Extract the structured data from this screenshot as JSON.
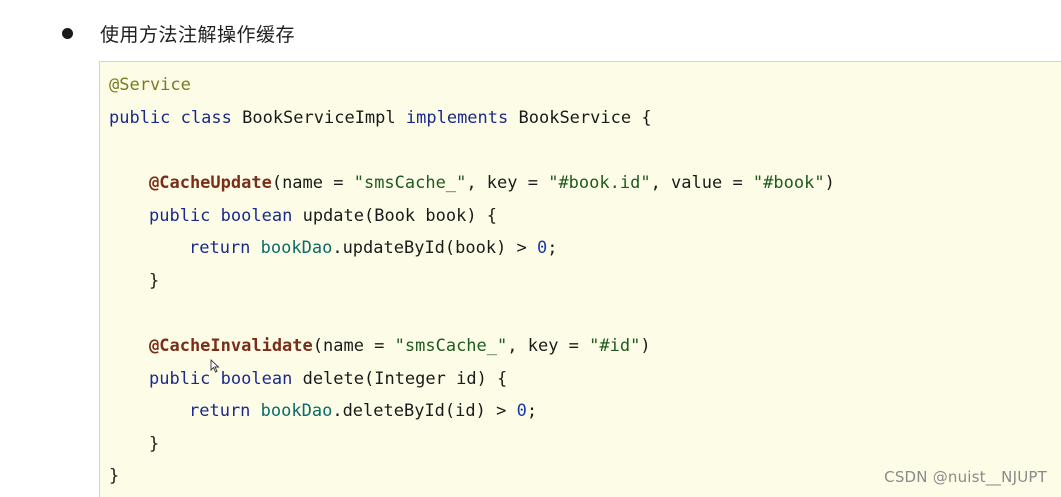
{
  "heading": {
    "bullet_text": "使用方法注解操作缓存"
  },
  "code": {
    "l1_annotation": "@Service",
    "l2": {
      "kw1": "public",
      "kw2": "class",
      "name": "BookServiceImpl",
      "kw3": "implements",
      "iface": "BookService",
      "brace": "{"
    },
    "l3_blank": "",
    "l4": {
      "ann": "@CacheUpdate",
      "p1": "(name = ",
      "s1": "\"smsCache_\"",
      "p2": ", key = ",
      "s2": "\"#book.id\"",
      "p3": ", value = ",
      "s3": "\"#book\"",
      "p4": ")"
    },
    "l5": {
      "kw1": "public",
      "kw2": "boolean",
      "rest": "update(Book book) {"
    },
    "l6": {
      "kw": "return",
      "var": "bookDao",
      "rest": ".updateById(book) > ",
      "num": "0",
      "end": ";"
    },
    "l7": "}",
    "l8_blank": "",
    "l9": {
      "ann": "@CacheInvalidate",
      "p1": "(name = ",
      "s1": "\"smsCache_\"",
      "p2": ", key = ",
      "s2": "\"#id\"",
      "p3": ")"
    },
    "l10": {
      "kw1": "public",
      "kw2": "boolean",
      "rest": "delete(Integer id) {"
    },
    "l11": {
      "kw": "return",
      "var": "bookDao",
      "rest": ".deleteById(id) > ",
      "num": "0",
      "end": ";"
    },
    "l12": "}",
    "l13": "}"
  },
  "watermark": "CSDN @nuist__NJUPT",
  "icons": {
    "bullet": "bullet-dot-icon",
    "cursor": "mouse-pointer-icon"
  },
  "colors": {
    "code_background": "#fdfde7",
    "annotation": "#7a2e1a",
    "keyword": "#1a2a8a",
    "string": "#1f5a1f"
  }
}
